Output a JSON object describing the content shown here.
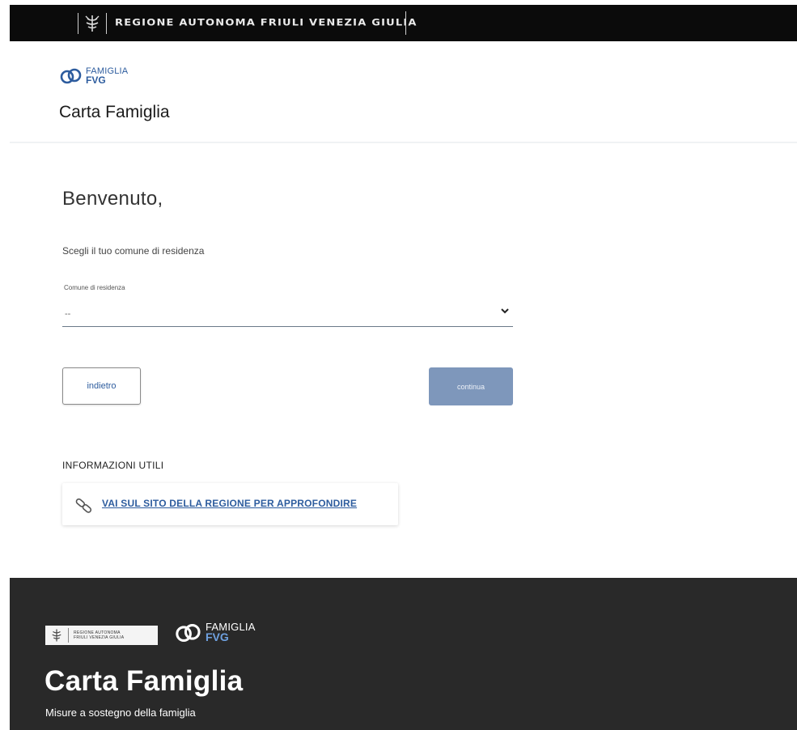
{
  "topbar": {
    "region_name": "REGIONE AUTONOMA FRIULI VENEZIA GIULIA",
    "crest_icon": "region-crest-icon",
    "background": "#0b0b0b"
  },
  "header": {
    "logo_line1": "FAMIGLIA",
    "logo_line2": "FVG",
    "logo_icon": "famiglia-infinity-icon",
    "title": "Carta Famiglia"
  },
  "main": {
    "welcome": "Benvenuto,",
    "instruction": "Scegli il tuo comune di residenza",
    "select": {
      "label": "Comune di residenza",
      "value": "--",
      "chevron_icon": "chevron-down-icon"
    },
    "buttons": {
      "back_label": "indietro",
      "continue_label": "continua"
    },
    "info": {
      "heading": "INFORMAZIONI UTILI",
      "link_icon": "link-icon",
      "link_label": "VAI SUL SITO DELLA REGIONE PER APPROFONDIRE"
    }
  },
  "footer": {
    "region_logo_line1": "REGIONE AUTONOMA",
    "region_logo_line2": "FRIULI VENEZIA GIULIA",
    "logo_line1": "FAMIGLIA",
    "logo_line2": "FVG",
    "title": "Carta Famiglia",
    "subtitle": "Misure a sostegno della famiglia"
  },
  "colors": {
    "brand_blue": "#2d5c9e",
    "button_disabled": "#7e97bb",
    "footer_bg": "#292929"
  }
}
